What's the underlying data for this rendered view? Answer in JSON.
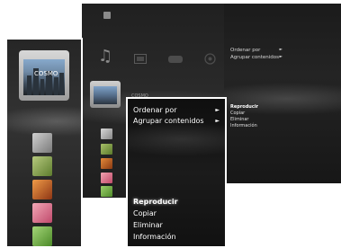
{
  "panel_right": {
    "menu_options": [
      {
        "label": "Ordenar por",
        "arrow": "►"
      },
      {
        "label": "Agrupar contenidos",
        "arrow": "►"
      }
    ],
    "menu_actions": [
      "Reproducir",
      "Copiar",
      "Eliminar",
      "Información"
    ]
  },
  "panel_mid": {
    "category_icons": [
      "music-note-icon",
      "video-icon",
      "gamepad-icon",
      "network-icon"
    ],
    "music_glyph": "♫",
    "folder_caption": "COSMO"
  },
  "panel_left": {
    "folder_label": "COSMO"
  },
  "context_menu": {
    "options": [
      {
        "label": "Ordenar por",
        "arrow": "►"
      },
      {
        "label": "Agrupar contenidos",
        "arrow": "►"
      }
    ],
    "actions": [
      "Reproducir",
      "Copiar",
      "Eliminar",
      "Información"
    ],
    "selected_action": "Reproducir"
  }
}
